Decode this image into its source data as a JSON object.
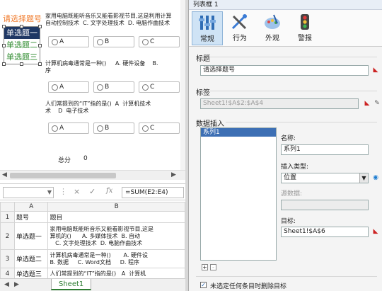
{
  "form": {
    "list_title": "请选择题号",
    "list_options": [
      "单选题一",
      "单选题二",
      "单选题三"
    ],
    "q1_text": "家用电脑既能听音乐又能看影视节目,这是利用计算\n自动控制技术  C. 文字处理技术  D. 电脑作曲技术",
    "q2_text": "计算机病毒通常是一种()     A. 硬件设备    B.\n序",
    "q3_text": "人们常提到的“IT”指的是()  A  计算机技术\n术    D  电子技术",
    "options": [
      "A",
      "B",
      "C"
    ],
    "total_label": "总分",
    "total_value": "0"
  },
  "formula_bar": {
    "name_box": "",
    "cancel_icon": "×",
    "enter_icon": "✓",
    "fx_icon": "fx",
    "formula": "=SUM(E2:E4)"
  },
  "sheet": {
    "col_headers": [
      "A",
      "B"
    ],
    "rows": [
      {
        "num": "1",
        "a": "题号",
        "b": "题目"
      },
      {
        "num": "2",
        "a": "单选题一",
        "b": "家用电脑既能听音乐又能看影视节目,这是\n算机的()      A. 多媒体技术  B. 自动\n   C. 文字处理技术  D. 电脑作曲技术"
      },
      {
        "num": "3",
        "a": "单选题二",
        "b": "计算机病毒通常是一种()       A. 硬件设\nB. 数据     C. Word文档     D. 程序"
      },
      {
        "num": "4",
        "a": "单选题三",
        "b": "人们常提到的“IT”指的是()   A  计算机"
      }
    ],
    "tab_label": "Sheet1"
  },
  "panel": {
    "title": "列表框 1",
    "tabs": [
      {
        "label": "常规",
        "icon": "general-tool-icon"
      },
      {
        "label": "行为",
        "icon": "behavior-icon"
      },
      {
        "label": "外观",
        "icon": "appearance-palette-icon"
      },
      {
        "label": "警报",
        "icon": "alert-light-icon"
      }
    ],
    "title_section": "标题",
    "title_value": "请选择题号",
    "tag_section": "标签",
    "tag_value": "Sheet1!$A$2:$A$4",
    "data_section": "数据插入",
    "series_item": "系列1",
    "name_label": "名称:",
    "name_value": "系列1",
    "insert_type_label": "插入类型:",
    "insert_type_value": "位置",
    "source_label": "源数据:",
    "source_value": "",
    "target_label": "目标:",
    "target_value": "Sheet1!$A$6",
    "add_symbol": "+",
    "remove_symbol": "-",
    "checkbox_checked": true,
    "checkbox_label": "未选定任何条目时删除目标"
  }
}
